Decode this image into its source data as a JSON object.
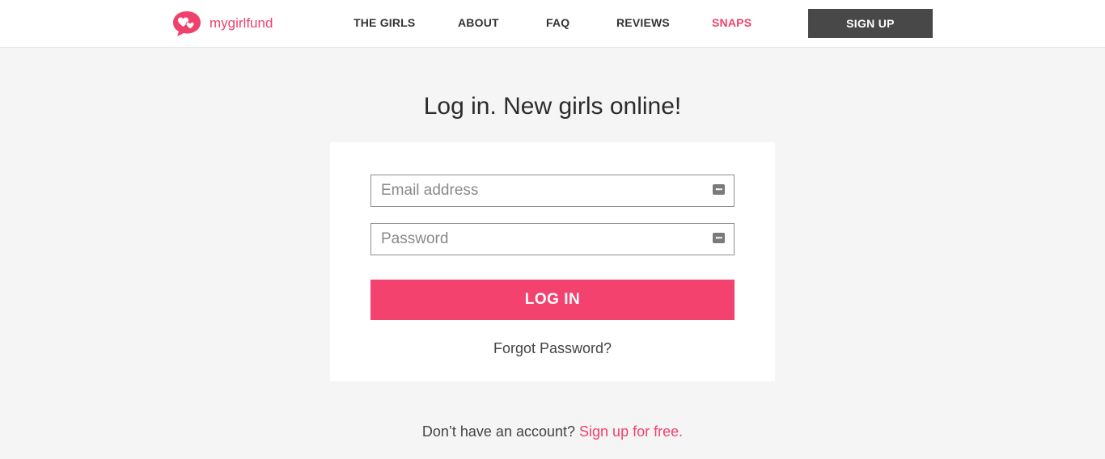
{
  "header": {
    "logo_text": "mygirlfund",
    "nav": {
      "the_girls": "THE GIRLS",
      "about": "ABOUT",
      "faq": "FAQ",
      "reviews": "REVIEWS",
      "snaps": "SNAPS"
    },
    "signup_label": "SIGN UP"
  },
  "main": {
    "title": "Log in. New girls online!",
    "email_placeholder": "Email address",
    "email_value": "",
    "password_placeholder": "Password",
    "password_value": "",
    "login_label": "LOG IN",
    "forgot_label": "Forgot Password?",
    "no_account_text": "Don’t have an account?",
    "signup_link": "Sign up for free."
  },
  "icons": {
    "logo": "hearts-speech-bubble-icon",
    "email_field_icon": "autofill-dots-icon",
    "password_field_icon": "autofill-dots-icon"
  },
  "colors": {
    "brand_pink": "#f0416c",
    "login_button": "#f4426f",
    "signup_button": "#484848",
    "page_background": "#f5f5f5",
    "card_background": "#ffffff"
  }
}
